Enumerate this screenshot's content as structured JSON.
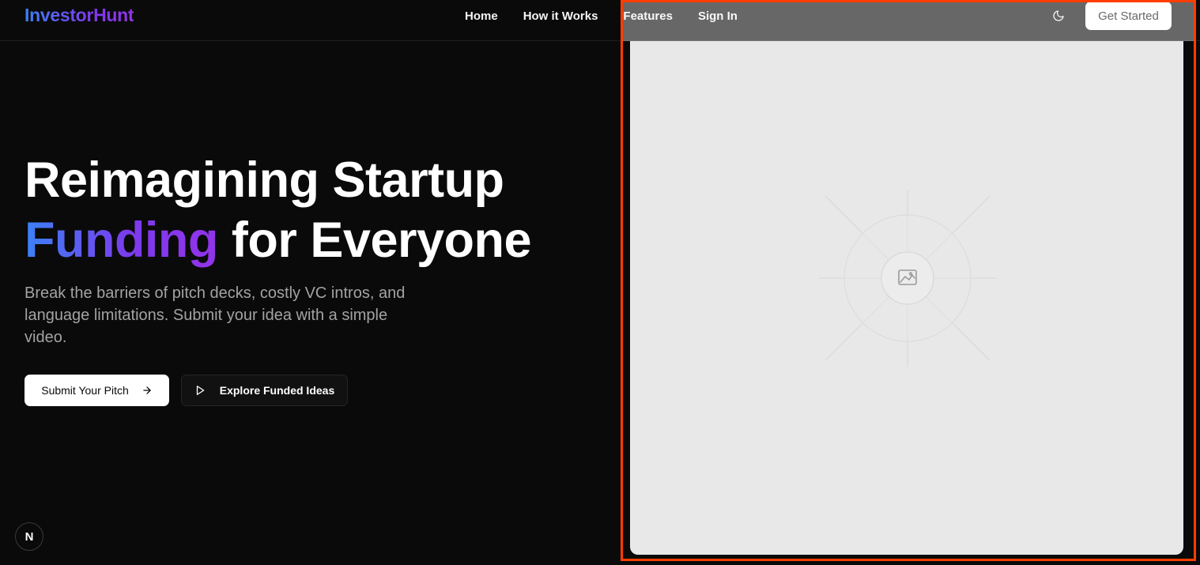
{
  "brand": {
    "name": "InvestorHunt",
    "gradient_start": "#3b82f6",
    "gradient_end": "#9333ea"
  },
  "nav": {
    "links": [
      "Home",
      "How it Works",
      "Features",
      "Sign In"
    ],
    "theme_toggle_icon": "moon-icon",
    "cta_label": "Get Started"
  },
  "hero": {
    "title_line1": "Reimagining Startup",
    "title_highlight": "Funding",
    "title_rest": "for Everyone",
    "description": "Break the barriers of pitch decks, costly VC intros, and language limitations. Submit your idea with a simple video.",
    "primary_button": {
      "label": "Submit Your Pitch",
      "icon": "arrow-right-icon"
    },
    "secondary_button": {
      "label": "Explore Funded Ideas",
      "icon": "play-icon"
    }
  },
  "media": {
    "placeholder_icon": "image-icon",
    "highlight_color": "#ff3d00",
    "background_color": "#e8e8e8"
  },
  "badge": {
    "label": "N"
  }
}
